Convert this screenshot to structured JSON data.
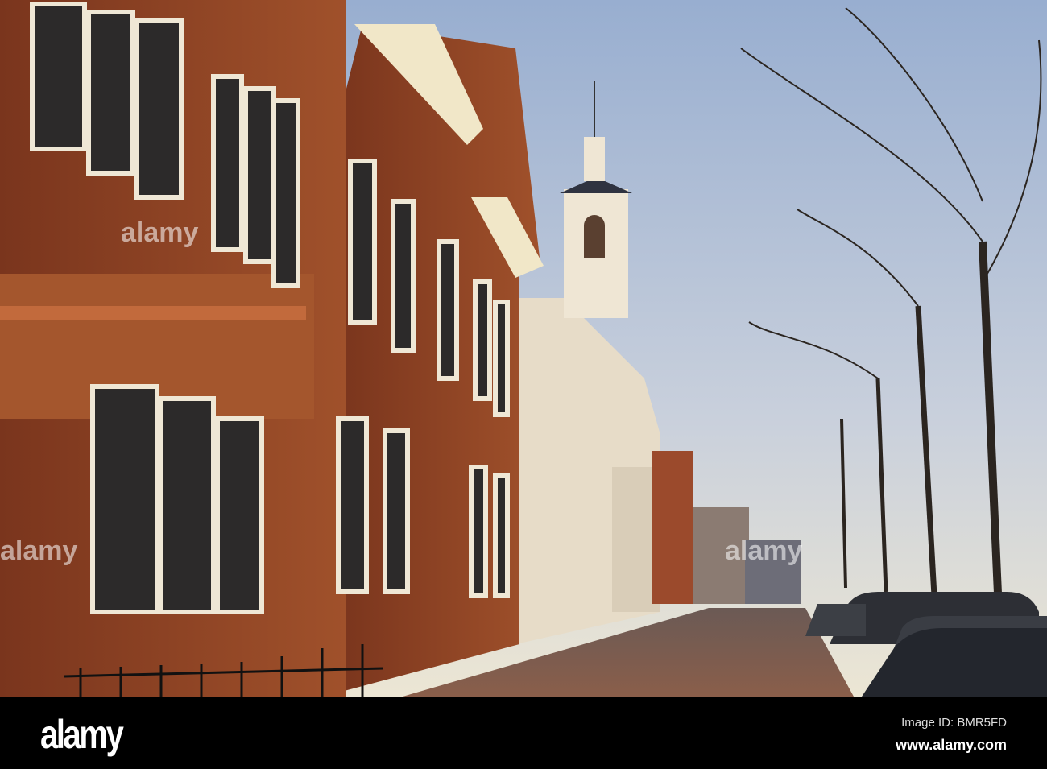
{
  "photo": {
    "subject": "Brick buildings and white church tower along a tree-lined street at sunset"
  },
  "watermark": {
    "brand": "alamy"
  },
  "footer": {
    "logo": "alamy",
    "image_id": "Image ID: BMR5FD",
    "website": "www.alamy.com"
  },
  "colors": {
    "sky_top": "#9fb4d2",
    "sky_bottom": "#e9e4d6",
    "brick": "#8a3f22",
    "footer": "#000000"
  }
}
